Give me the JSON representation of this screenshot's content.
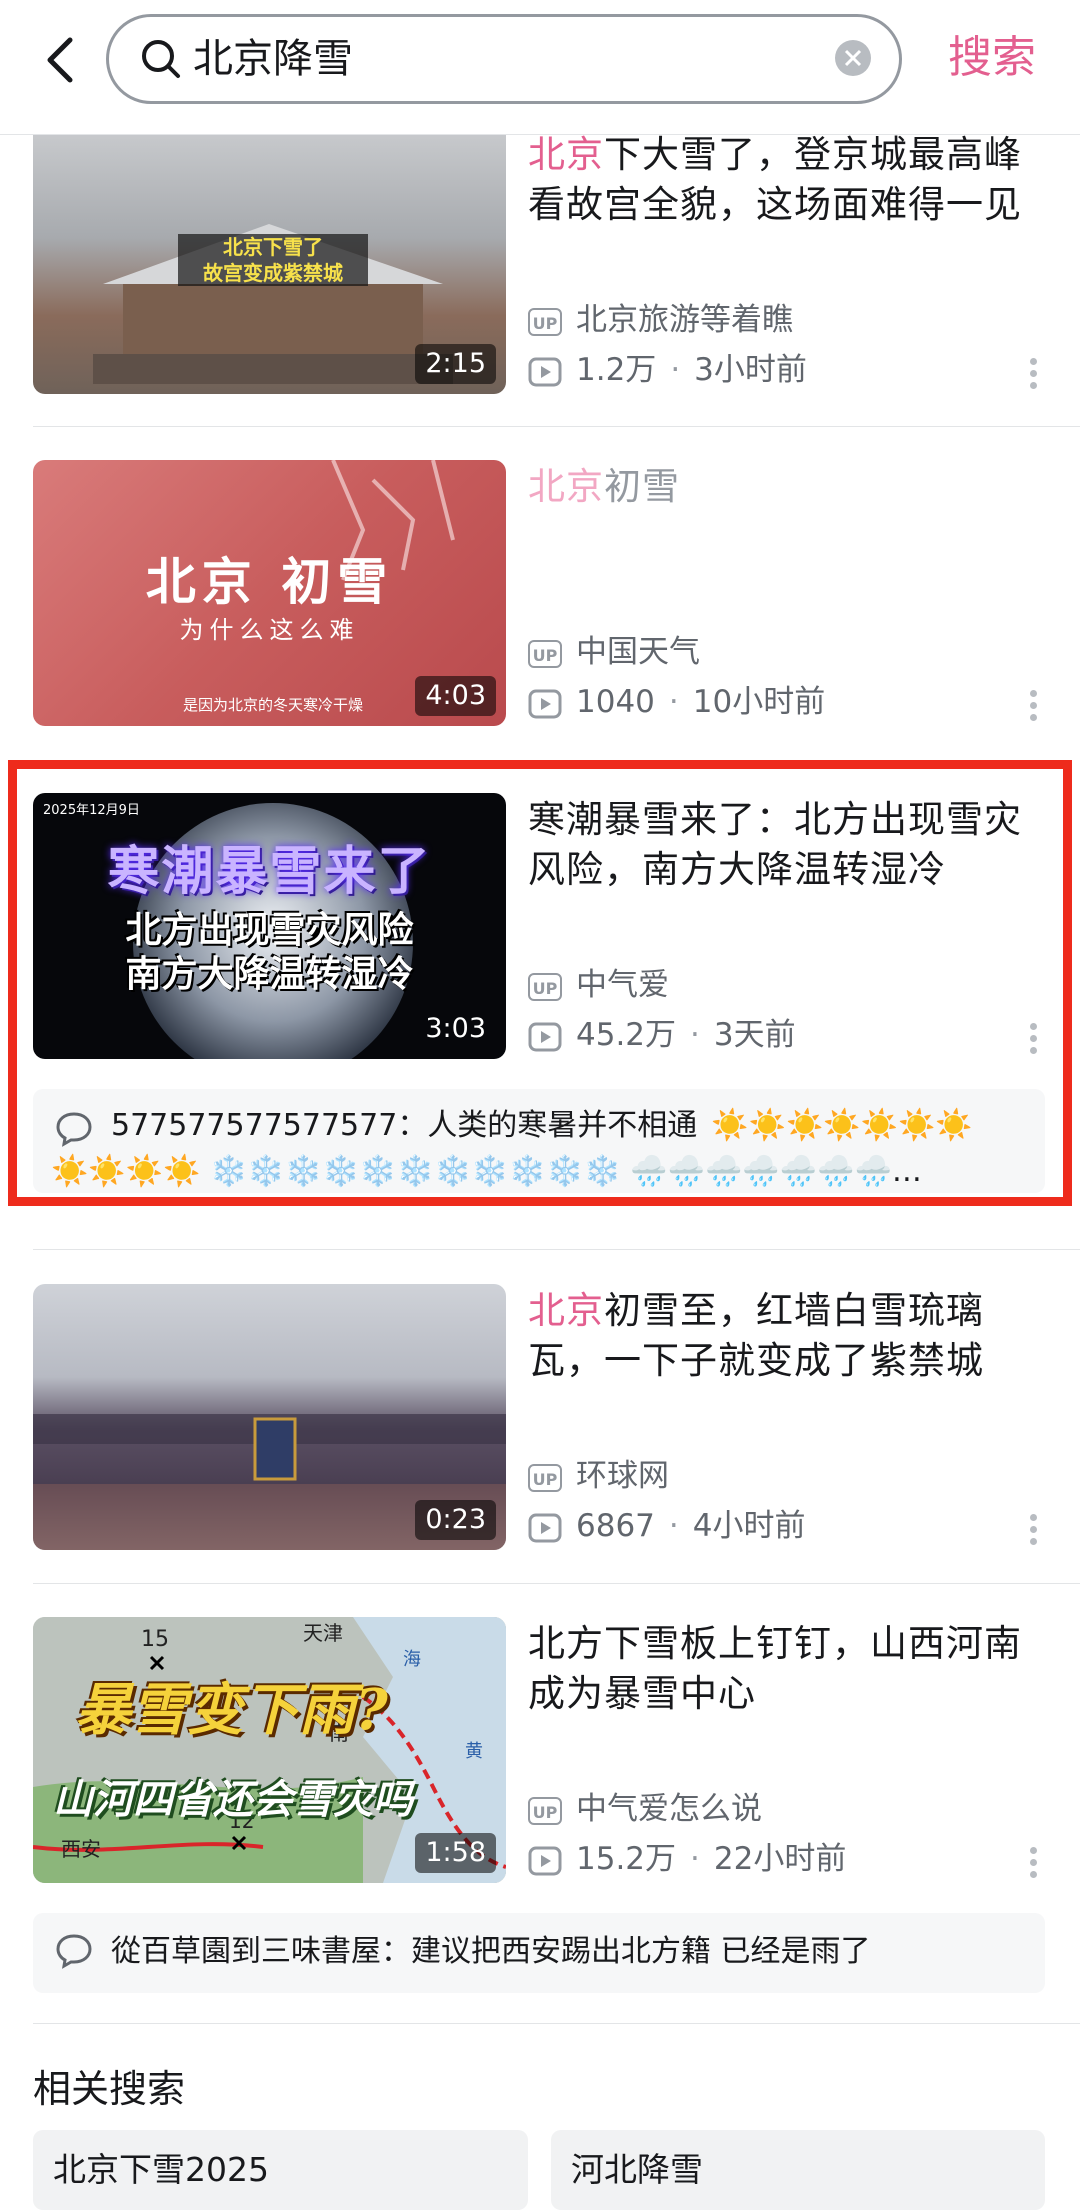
{
  "search": {
    "query": "北京降雪",
    "search_button": "搜索"
  },
  "results": [
    {
      "title_highlight": "北京",
      "title_rest": "下大雪了，登京城最高峰看故宫全貌，这场面难得一见",
      "thumb_caption_line1": "北京下雪了",
      "thumb_caption_line2": "故宫变成紫禁城",
      "duration": "2:15",
      "uploader": "北京旅游等着瞧",
      "views": "1.2万",
      "time": "3小时前"
    },
    {
      "title_highlight": "北京",
      "title_rest": "初雪",
      "thumb_caption_line1": "北京 初雪",
      "thumb_caption_line2": "为什么这么难",
      "thumb_caption_line3": "是因为北京的冬天寒冷干燥",
      "duration": "4:03",
      "uploader": "中国天气",
      "views": "1040",
      "time": "10小时前"
    },
    {
      "title_rest": "寒潮暴雪来了：北方出现雪灾风险，南方大降温转湿冷",
      "thumb_date": "2025年12月9日",
      "thumb_caption_line1": "寒潮暴雪来了",
      "thumb_caption_line2": "北方出现雪灾风险",
      "thumb_caption_line3": "南方大降温转湿冷",
      "duration": "3:03",
      "uploader": "中气爱",
      "views": "45.2万",
      "time": "3天前",
      "comment_user": "577577577577577",
      "comment_text": "人类的寒暑并不相通",
      "comment_emojis_line1": "☀️☀️☀️☀️☀️☀️☀️",
      "comment_emojis_line2": "☀️☀️☀️☀️ ❄️❄️❄️❄️❄️❄️❄️❄️❄️❄️❄️ 🌧️🌧️🌧️🌧️🌧️🌧️🌧️…"
    },
    {
      "title_highlight": "北京",
      "title_rest": "初雪至，红墙白雪琉璃瓦，一下子就变成了紫禁城",
      "duration": "0:23",
      "uploader": "环球网",
      "views": "6867",
      "time": "4小时前"
    },
    {
      "title_rest": "北方下雪板上钉钉，山西河南成为暴雪中心",
      "thumb_caption_line1": "暴雪变下雨?",
      "thumb_caption_line2": "山河四省还会雪灾吗",
      "map_labels": [
        "15",
        "天津",
        "12",
        "西安",
        "南",
        "海",
        "黄"
      ],
      "duration": "1:58",
      "uploader": "中气爱怎么说",
      "views": "15.2万",
      "time": "22小时前",
      "comment_user": "從百草園到三味書屋",
      "comment_text": "建议把西安踢出北方籍 已经是雨了"
    }
  ],
  "related": {
    "title": "相关搜索",
    "chips": [
      "北京下雪2025",
      "河北降雪"
    ]
  },
  "colors": {
    "accent": "#e35f8f",
    "highlight_border": "#ee2b1c"
  }
}
